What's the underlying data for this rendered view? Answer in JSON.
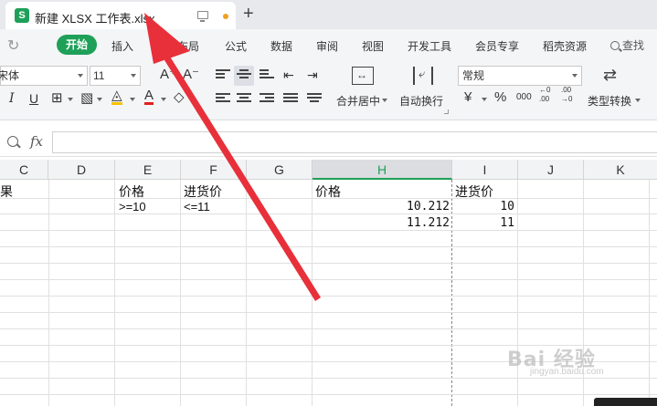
{
  "tab": {
    "logo": "S",
    "title": "新建 XLSX 工作表.xlsx",
    "new_tab": "+"
  },
  "menu": {
    "items": [
      "开始",
      "插入",
      "页面布局",
      "公式",
      "数据",
      "审阅",
      "视图",
      "开发工具",
      "会员专享",
      "稻壳资源"
    ],
    "active": "开始",
    "search_label": "查找"
  },
  "ribbon": {
    "font_name": "宋体",
    "font_size": "11",
    "grow_font": "A⁺",
    "shrink_font": "A⁻",
    "italic": "I",
    "underline": "U",
    "font_color": "A",
    "merge_label": "合并居中",
    "wrap_label": "自动换行",
    "number_format": "常规",
    "currency": "¥",
    "percent": "%",
    "thousands": "000",
    "inc_decimal": "←0 .00",
    "dec_decimal": ".00 →0",
    "convert_label": "类型转换",
    "accent_color": "#1ea059"
  },
  "formula_bar": {
    "fx": "fx",
    "content": ""
  },
  "columns": [
    "C",
    "D",
    "E",
    "F",
    "G",
    "H",
    "I",
    "J",
    "K"
  ],
  "selected_column": "H",
  "cells": {
    "c1": "果",
    "e1": "价格",
    "f1": "进货价",
    "h1": "价格",
    "i1": "进货价",
    "e2": ">=10",
    "f2": "<=11",
    "h2": "10.212",
    "i2": "10",
    "h3": "11.212",
    "i3": "11"
  },
  "watermark": {
    "brand": "Bai 经验",
    "url": "jingyan.baidu.com"
  },
  "annotation": {
    "arrow_color": "#e8303a"
  }
}
